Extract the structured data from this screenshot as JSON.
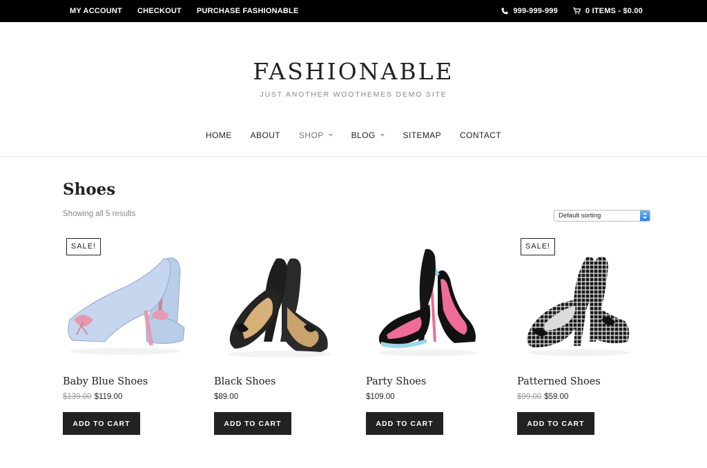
{
  "topbar": {
    "links": [
      "MY ACCOUNT",
      "CHECKOUT",
      "PURCHASE FASHIONABLE"
    ],
    "phone": "999-999-999",
    "cart": "0 ITEMS - $0.00"
  },
  "header": {
    "title": "FASHIONABLE",
    "description": "JUST ANOTHER WOOTHEMES DEMO SITE"
  },
  "nav": {
    "home": "HOME",
    "about": "ABOUT",
    "shop": "SHOP",
    "blog": "BLOG",
    "sitemap": "SITEMAP",
    "contact": "CONTACT"
  },
  "page": {
    "title": "Shoes",
    "result_count": "Showing all 5 results",
    "sorting": "Default sorting"
  },
  "products": [
    {
      "name": "Baby Blue Shoes",
      "old_price": "$139.00",
      "price": "$119.00",
      "sale": "SALE!",
      "button": "ADD TO CART",
      "image": "baby-blue-heels"
    },
    {
      "name": "Black Shoes",
      "old_price": "",
      "price": "$89.00",
      "sale": "",
      "button": "ADD TO CART",
      "image": "black-heels"
    },
    {
      "name": "Party Shoes",
      "old_price": "",
      "price": "$109.00",
      "sale": "",
      "button": "ADD TO CART",
      "image": "party-heels"
    },
    {
      "name": "Patterned Shoes",
      "old_price": "$99.00",
      "price": "$59.00",
      "sale": "SALE!",
      "button": "ADD TO CART",
      "image": "patterned-heels"
    }
  ],
  "colors": {
    "topbar": "#000000",
    "button": "#222222",
    "sale_old_price": "#999999",
    "select_accent": "#2a82e8"
  }
}
